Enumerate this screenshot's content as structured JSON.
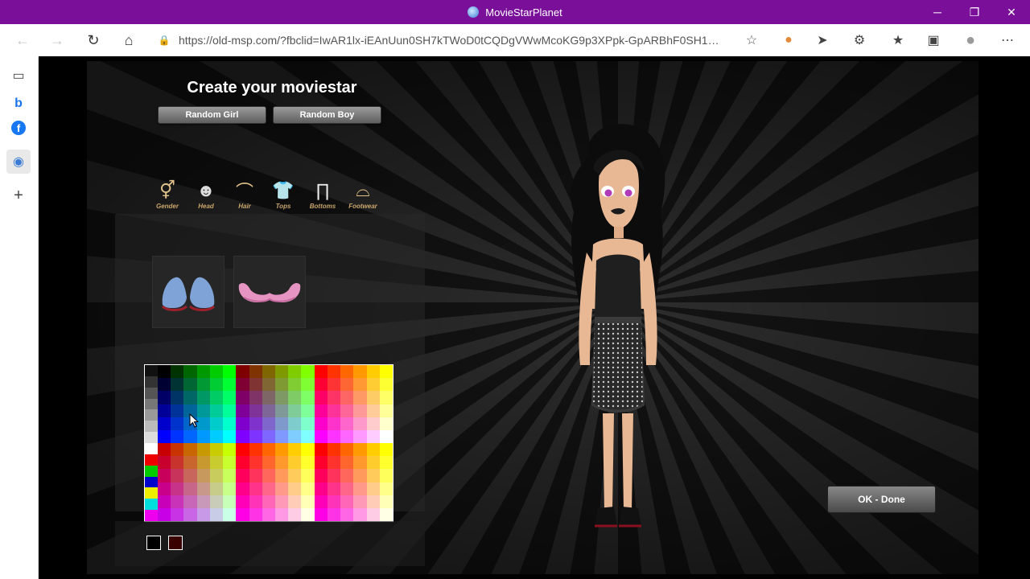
{
  "window": {
    "title": "MovieStarPlanet",
    "minimize": "─",
    "restore": "❐",
    "close": "✕"
  },
  "browser": {
    "back": "←",
    "forward": "→",
    "refresh": "↻",
    "home": "⌂",
    "lock": "🔒",
    "url": "https://old-msp.com/?fbclid=IwAR1lx-iEAnUun0SH7kTWoD0tCQDgVWwMcoKG9p3XPpk-GpARBhF0SH1Op...",
    "favorite": "☆",
    "tools": {
      "extension1": "●",
      "send": "➤",
      "extensions": "⚙",
      "favorites": "★",
      "collections": "▣",
      "profile": "●",
      "more": "⋯"
    }
  },
  "sidebar": {
    "tabs": "▭",
    "bing": "b",
    "facebook": "f",
    "msp": "◉",
    "add": "+"
  },
  "game": {
    "title": "Create your moviestar",
    "random_girl": "Random Girl",
    "random_boy": "Random Boy",
    "categories": [
      {
        "label": "Gender",
        "glyph": "⚥"
      },
      {
        "label": "Head",
        "glyph": "☻"
      },
      {
        "label": "Hair",
        "glyph": "⌒"
      },
      {
        "label": "Tops",
        "glyph": "👕"
      },
      {
        "label": "Bottoms",
        "glyph": "∏"
      },
      {
        "label": "Footwear",
        "glyph": "⌓"
      }
    ],
    "ok_done": "OK - Done",
    "selected_colors": [
      "#000000",
      "#3a0000"
    ]
  }
}
